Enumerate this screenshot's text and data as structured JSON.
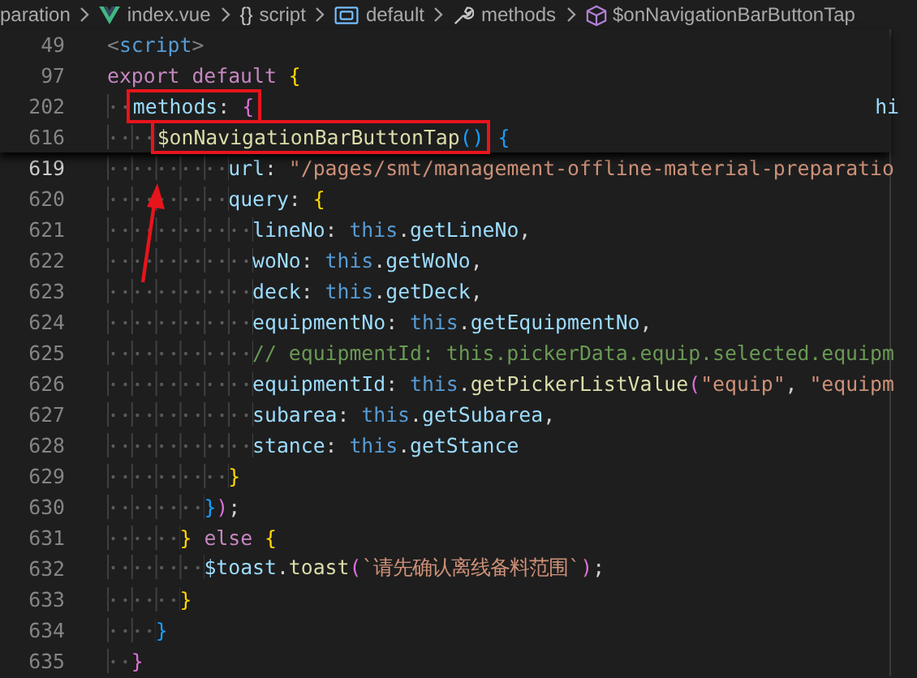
{
  "breadcrumbs": [
    {
      "kind": "folder",
      "label": "paration"
    },
    {
      "kind": "vue",
      "label": "index.vue"
    },
    {
      "kind": "braces",
      "icon_text": "{}",
      "label": "script"
    },
    {
      "kind": "module",
      "label": "default"
    },
    {
      "kind": "wrench",
      "label": "methods"
    },
    {
      "kind": "cube",
      "label": "$onNavigationBarButtonTap"
    }
  ],
  "sticky_lines": [
    {
      "number": "49",
      "tokens": [
        {
          "kind": "tag",
          "text": "<"
        },
        {
          "kind": "tag-name",
          "text": "script"
        },
        {
          "kind": "tag",
          "text": ">"
        }
      ]
    },
    {
      "number": "97",
      "tokens": [
        {
          "kind": "keyword",
          "text": "export default"
        },
        {
          "kind": "bracket-1",
          "text": " {"
        }
      ]
    },
    {
      "number": "202",
      "fragment": "hi",
      "tokens": [
        {
          "kind": "box",
          "children": [
            {
              "kind": "property",
              "text": "  methods"
            },
            {
              "kind": "plain",
              "text": ": "
            },
            {
              "kind": "bracket-2",
              "text": "{"
            }
          ]
        }
      ]
    },
    {
      "number": "616",
      "tokens": [
        {
          "kind": "box",
          "children": [
            {
              "kind": "function",
              "text": "    $onNavigationBarButtonTap"
            },
            {
              "kind": "bracket-3",
              "text": "()"
            }
          ]
        },
        {
          "kind": "bracket-3",
          "text": " {"
        }
      ]
    }
  ],
  "lines": [
    {
      "number": "619",
      "current": true,
      "tokens": [
        {
          "kind": "property",
          "text": "          url"
        },
        {
          "kind": "plain",
          "text": ": "
        },
        {
          "kind": "string",
          "text": "\"/pages/smt/management-offline-material-preparatio"
        }
      ]
    },
    {
      "number": "620",
      "current": false,
      "tokens": [
        {
          "kind": "property",
          "text": "          query"
        },
        {
          "kind": "plain",
          "text": ": "
        },
        {
          "kind": "bracket-1",
          "text": "{"
        }
      ]
    },
    {
      "number": "621",
      "current": false,
      "tokens": [
        {
          "kind": "property",
          "text": "            lineNo"
        },
        {
          "kind": "plain",
          "text": ": "
        },
        {
          "kind": "this",
          "text": "this"
        },
        {
          "kind": "plain",
          "text": "."
        },
        {
          "kind": "property",
          "text": "getLineNo"
        },
        {
          "kind": "plain",
          "text": ","
        }
      ]
    },
    {
      "number": "622",
      "current": false,
      "tokens": [
        {
          "kind": "property",
          "text": "            woNo"
        },
        {
          "kind": "plain",
          "text": ": "
        },
        {
          "kind": "this",
          "text": "this"
        },
        {
          "kind": "plain",
          "text": "."
        },
        {
          "kind": "property",
          "text": "getWoNo"
        },
        {
          "kind": "plain",
          "text": ","
        }
      ]
    },
    {
      "number": "623",
      "current": false,
      "tokens": [
        {
          "kind": "property",
          "text": "            deck"
        },
        {
          "kind": "plain",
          "text": ": "
        },
        {
          "kind": "this",
          "text": "this"
        },
        {
          "kind": "plain",
          "text": "."
        },
        {
          "kind": "property",
          "text": "getDeck"
        },
        {
          "kind": "plain",
          "text": ","
        }
      ]
    },
    {
      "number": "624",
      "current": false,
      "tokens": [
        {
          "kind": "property",
          "text": "            equipmentNo"
        },
        {
          "kind": "plain",
          "text": ": "
        },
        {
          "kind": "this",
          "text": "this"
        },
        {
          "kind": "plain",
          "text": "."
        },
        {
          "kind": "property",
          "text": "getEquipmentNo"
        },
        {
          "kind": "plain",
          "text": ","
        }
      ]
    },
    {
      "number": "625",
      "current": false,
      "tokens": [
        {
          "kind": "comment",
          "text": "            // equipmentId: this.pickerData.equip.selected.equipm"
        }
      ]
    },
    {
      "number": "626",
      "current": false,
      "tokens": [
        {
          "kind": "property",
          "text": "            equipmentId"
        },
        {
          "kind": "plain",
          "text": ": "
        },
        {
          "kind": "this",
          "text": "this"
        },
        {
          "kind": "plain",
          "text": "."
        },
        {
          "kind": "function",
          "text": "getPickerListValue"
        },
        {
          "kind": "bracket-2",
          "text": "("
        },
        {
          "kind": "string",
          "text": "\"equip\""
        },
        {
          "kind": "plain",
          "text": ", "
        },
        {
          "kind": "string",
          "text": "\"equipm"
        }
      ]
    },
    {
      "number": "627",
      "current": false,
      "tokens": [
        {
          "kind": "property",
          "text": "            subarea"
        },
        {
          "kind": "plain",
          "text": ": "
        },
        {
          "kind": "this",
          "text": "this"
        },
        {
          "kind": "plain",
          "text": "."
        },
        {
          "kind": "property",
          "text": "getSubarea"
        },
        {
          "kind": "plain",
          "text": ","
        }
      ]
    },
    {
      "number": "628",
      "current": false,
      "tokens": [
        {
          "kind": "property",
          "text": "            stance"
        },
        {
          "kind": "plain",
          "text": ": "
        },
        {
          "kind": "this",
          "text": "this"
        },
        {
          "kind": "plain",
          "text": "."
        },
        {
          "kind": "property",
          "text": "getStance"
        }
      ]
    },
    {
      "number": "629",
      "current": false,
      "tokens": [
        {
          "kind": "bracket-1",
          "text": "          }"
        }
      ]
    },
    {
      "number": "630",
      "current": false,
      "tokens": [
        {
          "kind": "bracket-3",
          "text": "        }"
        },
        {
          "kind": "bracket-2",
          "text": ")"
        },
        {
          "kind": "plain",
          "text": ";"
        }
      ]
    },
    {
      "number": "631",
      "current": false,
      "tokens": [
        {
          "kind": "bracket-1",
          "text": "      }"
        },
        {
          "kind": "keyword",
          "text": " else"
        },
        {
          "kind": "bracket-1",
          "text": " {"
        }
      ]
    },
    {
      "number": "632",
      "current": false,
      "tokens": [
        {
          "kind": "property",
          "text": "        $toast"
        },
        {
          "kind": "plain",
          "text": "."
        },
        {
          "kind": "function",
          "text": "toast"
        },
        {
          "kind": "bracket-2",
          "text": "("
        },
        {
          "kind": "string",
          "text": "`请先确认离线备料范围`"
        },
        {
          "kind": "bracket-2",
          "text": ")"
        },
        {
          "kind": "plain",
          "text": ";"
        }
      ]
    },
    {
      "number": "633",
      "current": false,
      "tokens": [
        {
          "kind": "bracket-1",
          "text": "      }"
        }
      ]
    },
    {
      "number": "634",
      "current": false,
      "tokens": [
        {
          "kind": "bracket-3",
          "text": "    }"
        }
      ]
    },
    {
      "number": "635",
      "current": false,
      "tokens": [
        {
          "kind": "bracket-2",
          "text": "  }"
        }
      ]
    }
  ]
}
